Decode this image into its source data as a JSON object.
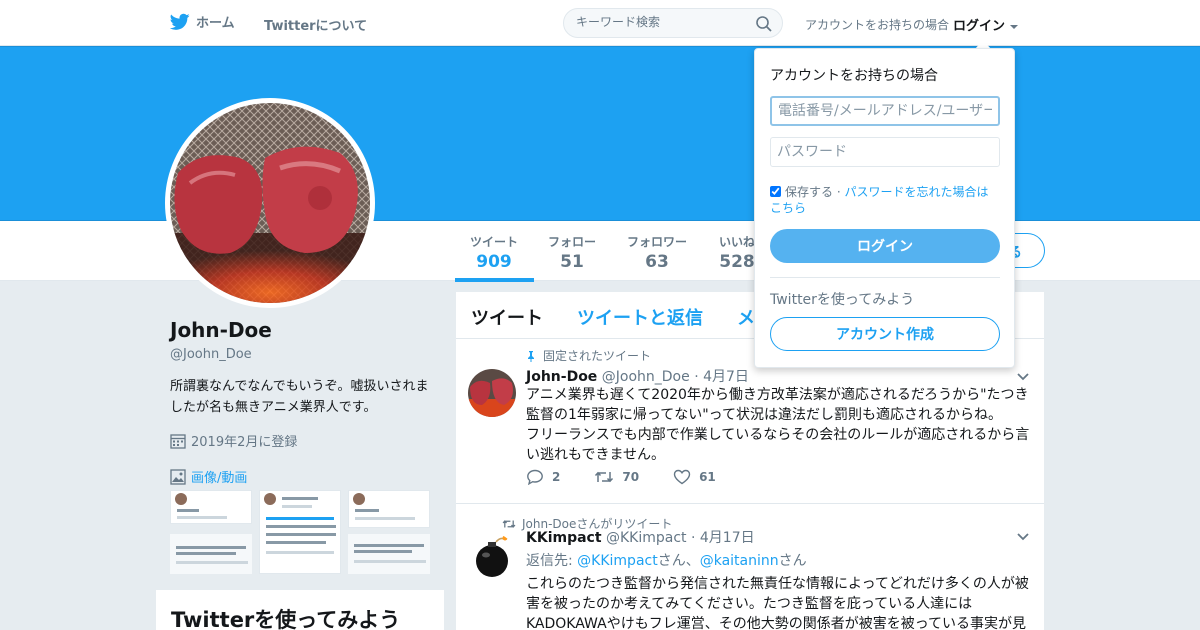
{
  "nav": {
    "home_label": "ホーム",
    "about_label": "Twitterについて",
    "search_placeholder": "キーワード検索",
    "login_prompt": "アカウントをお持ちの場合",
    "login_link": "ログイン"
  },
  "colors": {
    "brand": "#1da1f2",
    "banner": "#1da1f2"
  },
  "profile": {
    "name": "John-Doe",
    "handle": "@Joohn_Doe",
    "bio": "所謂裏なんでなんでもいうぞ。嘘扱いされましたが名も無きアニメ業界人です。",
    "joined": "2019年2月に登録",
    "media_label": "画像/動画",
    "try_title": "Twitterを使ってみよう"
  },
  "stats": [
    {
      "label": "ツイート",
      "value": "909"
    },
    {
      "label": "フォロー",
      "value": "51"
    },
    {
      "label": "フォロワー",
      "value": "63"
    },
    {
      "label": "いいね",
      "value": "528"
    }
  ],
  "follow_button_partial": "る",
  "tabs": [
    {
      "label": "ツイート"
    },
    {
      "label": "ツイートと返信"
    },
    {
      "label": "メ"
    }
  ],
  "tweets": [
    {
      "context": "固定されたツイート",
      "name": "John-Doe",
      "handle": "@Joohn_Doe",
      "date": "· 4月7日",
      "text_lines": [
        "アニメ業界も遅くて2020年から働き方改革法案が適応されるだろうから\"たつき",
        "監督の1年弱家に帰ってない\"って状況は違法だし罰則も適応されるからね。",
        "フリーランスでも内部で作業しているならその会社のルールが適応されるから言",
        "い逃れもできません。"
      ],
      "replies": "2",
      "retweets": "70",
      "likes": "61"
    },
    {
      "context": "John-Doeさんがリツイート",
      "name": "KKimpact",
      "handle": "@KKimpact",
      "date": "· 4月17日",
      "reply_to_prefix": "返信先: ",
      "reply_user_1": "@KKimpact",
      "reply_sep": "さん、",
      "reply_user_2": "@kaitaninn",
      "reply_suffix": "さん",
      "text_lines": [
        "これらのたつき監督から発信された無責任な情報によってどれだけ多くの人が被",
        "害を被ったのか考えてみてください。たつき監督を庇っている人達には",
        "KADOKAWAやけもフレ運営、その他大勢の関係者が被害を被っている事実が見"
      ]
    }
  ],
  "login_dropdown": {
    "title": "アカウントをお持ちの場合",
    "username_placeholder": "電話番号/メールアドレス/ユーザー名",
    "password_placeholder": "パスワード",
    "remember": "保存する",
    "sep": " · ",
    "forgot": "パスワードを忘れた場合はこちら",
    "login_button": "ログイン",
    "try_text": "Twitterを使ってみよう",
    "signup_button": "アカウント作成"
  }
}
